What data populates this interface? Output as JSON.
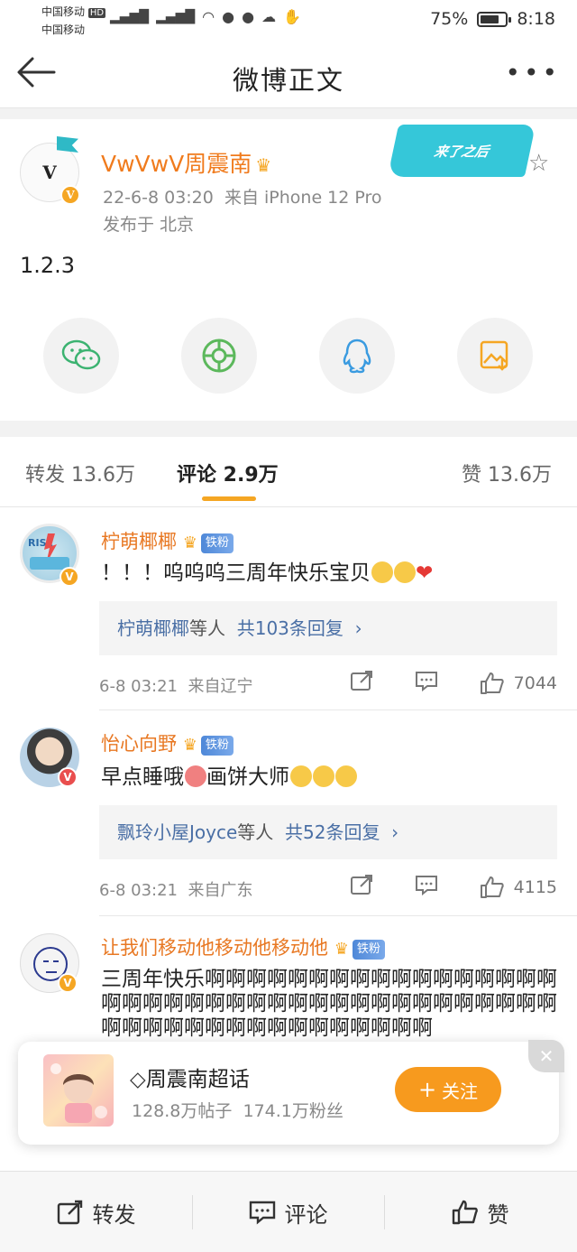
{
  "status_bar": {
    "carrier1": "中国移动",
    "carrier1_badge": "HD",
    "carrier2": "中国移动",
    "signal_label": "4G",
    "battery_text": "75%",
    "battery_level": 0.75,
    "time": "8:18"
  },
  "nav": {
    "title": "微博正文"
  },
  "post": {
    "author": "VwVwV周震南",
    "avatar_letter": "V",
    "date": "22-6-8 03:20",
    "source": "来自 iPhone 12 Pro",
    "location": "发布于 北京",
    "banner_text": "来了之后",
    "body": "1.2.3",
    "share_icons": [
      "wechat-icon",
      "moments-icon",
      "qq-icon",
      "save-image-icon"
    ]
  },
  "tabs": {
    "repost": "转发 13.6万",
    "comments": "评论 2.9万",
    "likes": "赞 13.6万"
  },
  "comments": [
    {
      "name": "柠萌椰椰",
      "badge": "铁粉",
      "text": "！！！呜呜呜三周年快乐宝贝",
      "reply_names": "柠萌椰椰",
      "reply_mid": "等人",
      "reply_count": "共103条回复",
      "time": "6-8 03:21",
      "source": "来自辽宁",
      "likes": "7044"
    },
    {
      "name": "怡心向野",
      "badge": "铁粉",
      "text": "早点睡哦",
      "text_tail": "画饼大师",
      "reply_names": "飘玲小屋Joyce",
      "reply_mid": "等人",
      "reply_count": "共52条回复",
      "time": "6-8 03:21",
      "source": "来自广东",
      "likes": "4115"
    },
    {
      "name": "让我们移动他移动他移动他",
      "badge": "铁粉",
      "text": "三周年快乐啊啊啊啊啊啊啊啊啊啊啊啊啊啊啊啊啊啊啊啊啊啊啊啊啊啊啊啊啊啊啊啊啊啊啊啊啊啊啊啊啊啊啊啊啊啊啊啊啊啊啊啊啊啊啊"
    }
  ],
  "topic_card": {
    "title": "周震南超话",
    "posts": "128.8万帖子",
    "fans": "174.1万粉丝",
    "follow_label": "关注"
  },
  "bottom_bar": {
    "repost": "转发",
    "comment": "评论",
    "like": "赞"
  },
  "colors": {
    "accent": "#f5a623",
    "name_orange": "#e87823",
    "link_blue": "#4a6fa5",
    "follow_orange": "#f79a1e"
  }
}
